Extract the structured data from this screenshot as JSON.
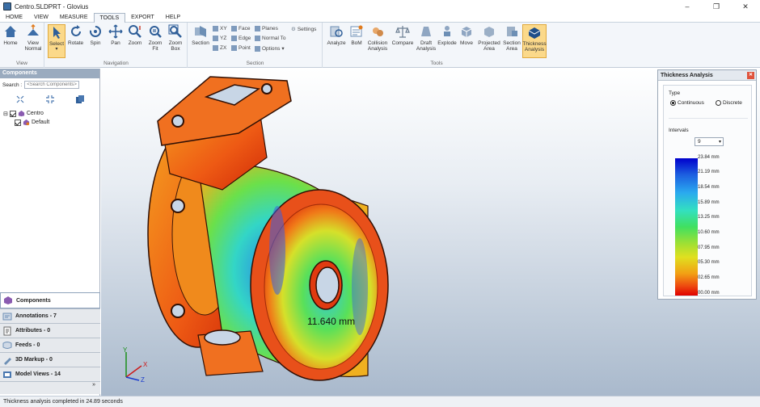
{
  "window": {
    "title": "Centro.SLDPRT - Glovius",
    "controls": [
      "–",
      "❐",
      "✕"
    ]
  },
  "menu": {
    "tabs": [
      "HOME",
      "VIEW",
      "MEASURE",
      "TOOLS",
      "EXPORT",
      "HELP"
    ],
    "active": "TOOLS"
  },
  "ribbon": {
    "view_group": {
      "caption": "View",
      "buttons": [
        "Home",
        "View Normal"
      ]
    },
    "nav_group": {
      "caption": "Navigation",
      "buttons": [
        "Select",
        "Rotate",
        "Spin",
        "Pan",
        "Zoom",
        "Zoom Fit",
        "Zoom Box"
      ]
    },
    "section_group": {
      "caption": "Section",
      "section_label": "Section",
      "xy": "XY",
      "yz": "YZ",
      "zx": "ZX",
      "face": "Face",
      "edge": "Edge",
      "point": "Point",
      "planes": "Planes",
      "normal_to": "Normal To",
      "options": "Options",
      "settings": "Settings"
    },
    "tools_group": {
      "caption": "Tools",
      "buttons": [
        "Analyze",
        "BoM",
        "Collision Analysis",
        "Compare",
        "Draft Analysis",
        "Explode",
        "Move",
        "Projected Area",
        "Section Area",
        "Thickness Analysis"
      ]
    }
  },
  "left": {
    "header": "Components",
    "search_label": "Search :",
    "search_placeholder": "<Search Components>",
    "tree": [
      {
        "label": "Centro"
      },
      {
        "label": "Default"
      }
    ],
    "tabs": [
      {
        "label": "Components"
      },
      {
        "label": "Annotations - 7"
      },
      {
        "label": "Attributes - 0"
      },
      {
        "label": "Feeds - 0"
      },
      {
        "label": "3D Markup - 0"
      },
      {
        "label": "Model Views - 14"
      }
    ],
    "more": "»"
  },
  "viewport": {
    "measurement": "11.640  mm",
    "axes": [
      "Y",
      "X",
      "Z"
    ]
  },
  "thickness": {
    "title": "Thickness Analysis",
    "type_label": "Type",
    "continuous": "Continuous",
    "discrete": "Discrete",
    "selected_type": "Continuous",
    "intervals_label": "Intervals",
    "intervals_value": "9",
    "legend": [
      "23.84  mm",
      "21.19  mm",
      "18.54  mm",
      "15.89  mm",
      "13.25  mm",
      "10.60  mm",
      "07.95  mm",
      "05.30  mm",
      "02.65  mm",
      "00.00  mm"
    ]
  },
  "status": {
    "text": "Thickness analysis completed  in 24.89 seconds"
  }
}
